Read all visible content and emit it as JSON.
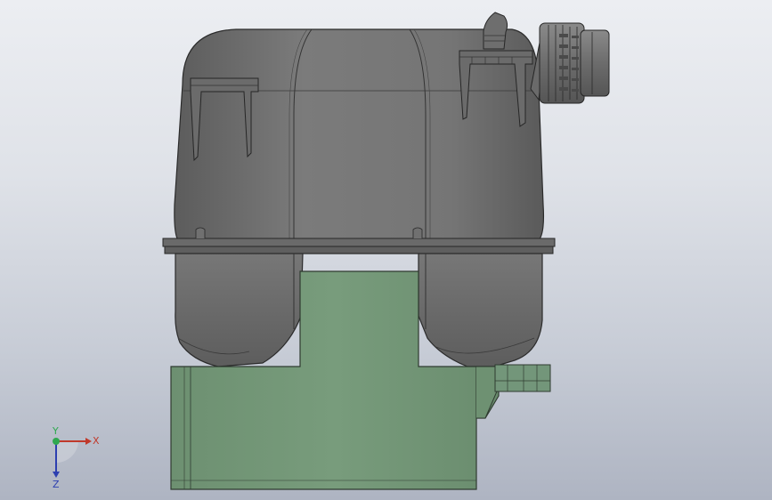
{
  "viewport": {
    "colors": {
      "background_top": "#eceef2",
      "background_bottom": "#aeb4c2",
      "tank_body": "#6f6f6f",
      "tank_edge": "#2b2b2b",
      "base_block": "#76997a",
      "base_edge": "#2f3b30"
    }
  },
  "triad": {
    "x_label": "X",
    "y_label": "Y",
    "z_label": "Z",
    "colors": {
      "x": "#c0392b",
      "y": "#2fa84f",
      "z": "#2c3fb0"
    }
  }
}
